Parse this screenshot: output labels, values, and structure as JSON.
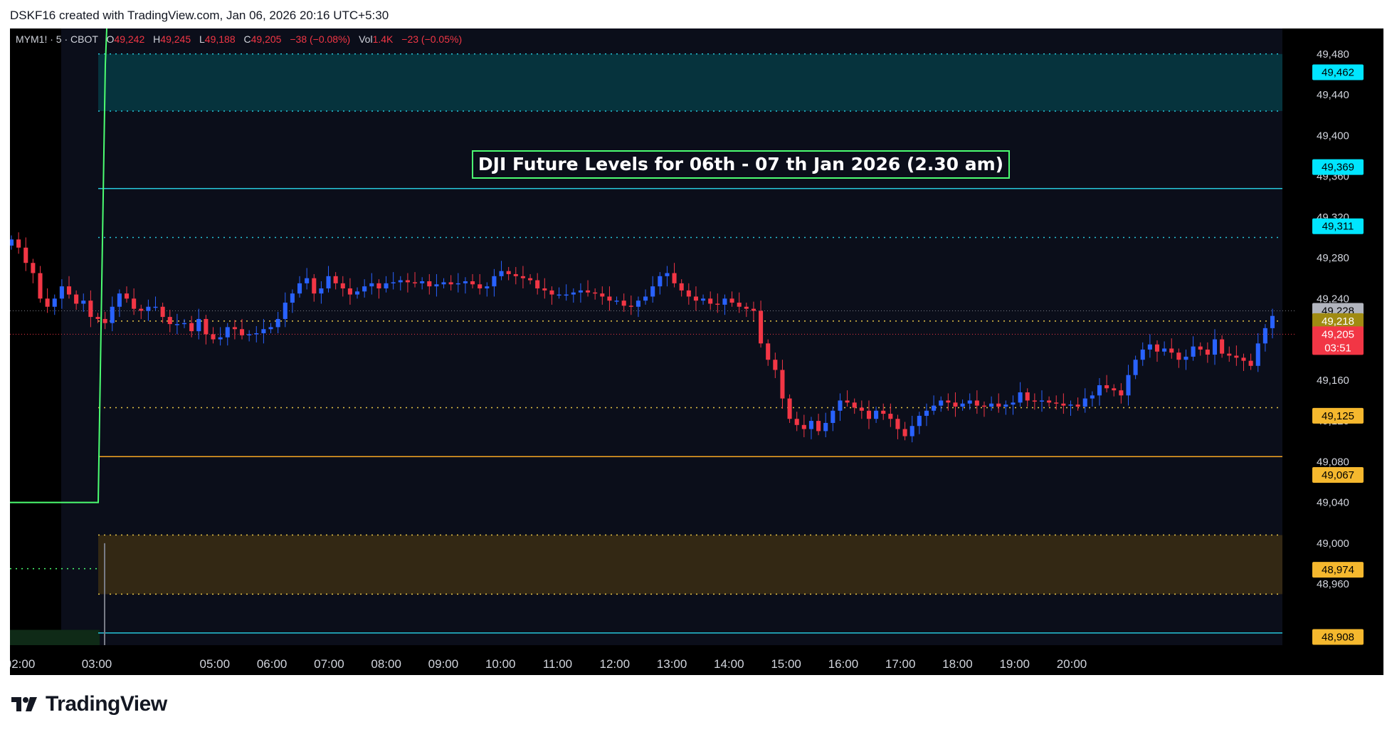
{
  "header": {
    "text": "DSKF16 created with TradingView.com, Jan 06, 2026 20:16 UTC+5:30"
  },
  "legend": {
    "symbol": "MYM1! · 5 · CBOT",
    "o_label": "O",
    "o_value": "49,242",
    "h_label": "H",
    "h_value": "49,245",
    "l_label": "L",
    "l_value": "49,188",
    "c_label": "C",
    "c_value": "49,205",
    "change": "−38 (−0.08%)",
    "vol_label": "Vol",
    "vol_value": "1.4K",
    "vol_change": "−23 (−0.05%)"
  },
  "annotation": {
    "text": "DJI Future Levels for 06th - 07 th Jan 2026 (2.30 am)"
  },
  "colors": {
    "background": "#0b0e1a",
    "up": "#2962ff",
    "down": "#f23645",
    "cyan": "#26c6da",
    "yellow": "#e8c547",
    "orange": "#f5a623",
    "green": "#4cff72"
  },
  "price_axis": {
    "ticks": [
      "49,480",
      "49,440",
      "49,400",
      "49,360",
      "49,320",
      "49,280",
      "49,240",
      "49,200",
      "49,160",
      "49,120",
      "49,080",
      "49,040",
      "49,000",
      "48,960"
    ],
    "tick_values": [
      49480,
      49440,
      49400,
      49360,
      49320,
      49280,
      49240,
      49200,
      49160,
      49120,
      49080,
      49040,
      49000,
      48960
    ],
    "labels": [
      {
        "text": "49,462",
        "value": 49462,
        "bg": "#00e5ff",
        "fg": "#000000"
      },
      {
        "text": "49,369",
        "value": 49369,
        "bg": "#00e5ff",
        "fg": "#000000"
      },
      {
        "text": "49,311",
        "value": 49311,
        "bg": "#00e5ff",
        "fg": "#000000"
      },
      {
        "text": "49,228",
        "value": 49228,
        "bg": "#b2b5be",
        "fg": "#000000"
      },
      {
        "text": "49,218",
        "value": 49218,
        "bg": "#a08b12",
        "fg": "#ffffff"
      },
      {
        "text": "49,205",
        "value": 49205,
        "bg": "#f23645",
        "fg": "#ffffff",
        "sub": "03:51"
      },
      {
        "text": "49,125",
        "value": 49125,
        "bg": "#f5b82e",
        "fg": "#000000"
      },
      {
        "text": "49,067",
        "value": 49067,
        "bg": "#f5b82e",
        "fg": "#000000"
      },
      {
        "text": "48,974",
        "value": 48974,
        "bg": "#f5b82e",
        "fg": "#000000"
      },
      {
        "text": "48,908",
        "value": 48908,
        "bg": "#f5b82e",
        "fg": "#000000"
      }
    ]
  },
  "time_axis": {
    "ticks": [
      "02:00",
      "03:00",
      "05:00",
      "06:00",
      "07:00",
      "08:00",
      "09:00",
      "10:00",
      "11:00",
      "12:00",
      "13:00",
      "14:00",
      "15:00",
      "16:00",
      "17:00",
      "18:00",
      "19:00",
      "20:00"
    ],
    "tick_hours": [
      2,
      3,
      4.0,
      5.0,
      6.0,
      7.0,
      8.0,
      9.0,
      10.0,
      11.0,
      12.0,
      13.0,
      14.0,
      15.0,
      16.0,
      17.0,
      18.0,
      19.0
    ]
  },
  "chart_data": {
    "type": "candlestick",
    "symbol": "MYM1!",
    "interval": "5",
    "ylim": [
      48900,
      49505
    ],
    "levels": [
      {
        "price": 49480,
        "style": "dotted",
        "color": "cyan"
      },
      {
        "price": 49424,
        "style": "dotted",
        "color": "cyan"
      },
      {
        "price": 49348,
        "style": "solid",
        "color": "cyan"
      },
      {
        "price": 49300,
        "style": "dotted",
        "color": "cyan"
      },
      {
        "price": 49218,
        "style": "dotted",
        "color": "yellow"
      },
      {
        "price": 49133,
        "style": "dotted",
        "color": "yellow"
      },
      {
        "price": 49085,
        "style": "solid",
        "color": "orange"
      },
      {
        "price": 49008,
        "style": "dotted",
        "color": "yellow"
      },
      {
        "price": 48950,
        "style": "dotted",
        "color": "yellow"
      },
      {
        "price": 48912,
        "style": "solid",
        "color": "cyan"
      }
    ],
    "closes": [
      49298,
      49290,
      49275,
      49265,
      49240,
      49232,
      49240,
      49252,
      49244,
      49235,
      49238,
      49222,
      49220,
      49216,
      49232,
      49245,
      49240,
      49230,
      49228,
      49232,
      49232,
      49222,
      49215,
      49215,
      49216,
      49208,
      49220,
      49205,
      49200,
      49202,
      49212,
      49210,
      49204,
      49205,
      49206,
      49210,
      49212,
      49220,
      49236,
      49245,
      49255,
      49260,
      49245,
      49250,
      49262,
      49255,
      49250,
      49244,
      49247,
      49252,
      49255,
      49250,
      49255,
      49256,
      49258,
      49256,
      49255,
      49257,
      49252,
      49254,
      49256,
      49254,
      49255,
      49257,
      49254,
      49250,
      49252,
      49262,
      49267,
      49264,
      49262,
      49260,
      49258,
      49250,
      49248,
      49244,
      49244,
      49244,
      49246,
      49248,
      49246,
      49245,
      49242,
      49238,
      49238,
      49233,
      49232,
      49238,
      49242,
      49252,
      49262,
      49265,
      49255,
      49248,
      49242,
      49238,
      49240,
      49235,
      49234,
      49240,
      49236,
      49232,
      49230,
      49228,
      49196,
      49180,
      49170,
      49142,
      49122,
      49116,
      49112,
      49120,
      49110,
      49118,
      49130,
      49140,
      49138,
      49133,
      49130,
      49122,
      49130,
      49127,
      49122,
      49112,
      49105,
      49115,
      49125,
      49130,
      49135,
      49140,
      49138,
      49134,
      49137,
      49140,
      49135,
      49134,
      49137,
      49134,
      49136,
      49138,
      49148,
      49140,
      49139,
      49140,
      49138,
      49137,
      49135,
      49136,
      49134,
      49142,
      49145,
      49155,
      49152,
      49150,
      49145,
      49165,
      49180,
      49190,
      49195,
      49188,
      49191,
      49187,
      49180,
      49183,
      49193,
      49190,
      49185,
      49200,
      49186,
      49184,
      49182,
      49179,
      49174,
      49196,
      49211,
      49223
    ],
    "last_close": 49205,
    "last_close_time": "20:00"
  }
}
